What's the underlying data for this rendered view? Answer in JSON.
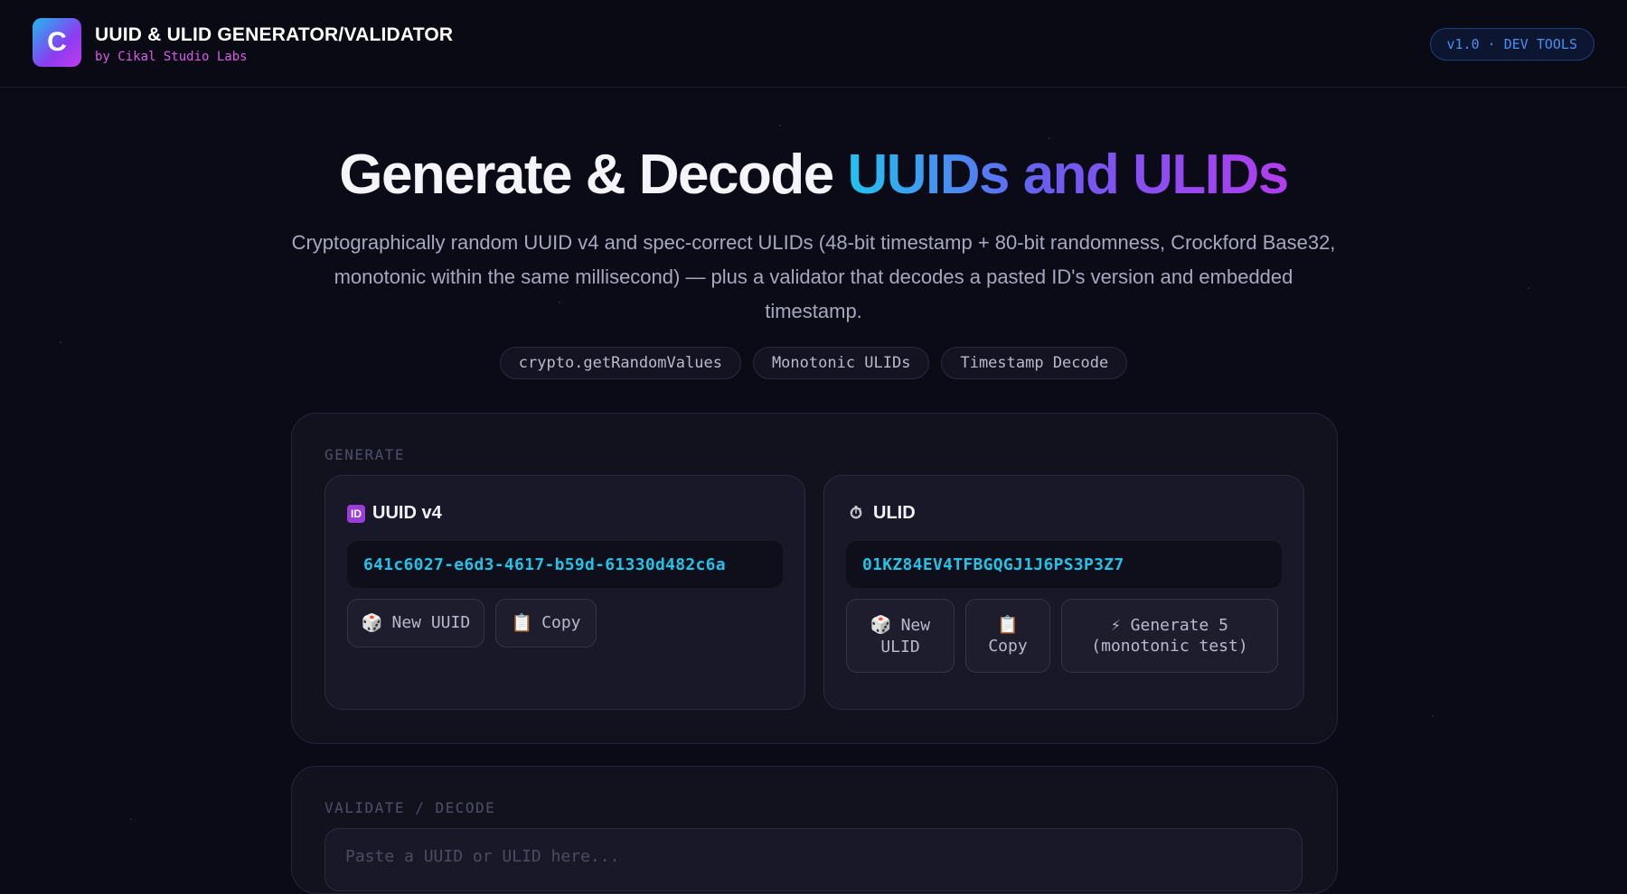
{
  "header": {
    "logo_letter": "C",
    "title": "UUID & ULID GENERATOR/VALIDATOR",
    "subtitle": "by Cikal Studio Labs",
    "version": "v1.0 · DEV TOOLS"
  },
  "hero": {
    "title_plain": "Generate & Decode ",
    "title_highlight": "UUIDs and ULIDs",
    "description": "Cryptographically random UUID v4 and spec-correct ULIDs (48-bit timestamp + 80-bit randomness, Crockford Base32, monotonic within the same millisecond) — plus a validator that decodes a pasted ID's version and embedded timestamp.",
    "chips": [
      "crypto.getRandomValues",
      "Monotonic ULIDs",
      "Timestamp Decode"
    ]
  },
  "generate": {
    "section_label": "GENERATE",
    "uuid": {
      "icon": "id-icon",
      "icon_text": "ID",
      "title": "UUID v4",
      "value": "641c6027-e6d3-4617-b59d-61330d482c6a",
      "new_label": "New UUID",
      "new_emoji": "🎲",
      "copy_label": "Copy",
      "copy_emoji": "📋"
    },
    "ulid": {
      "icon": "stopwatch-icon",
      "icon_text": "⏱",
      "title": "ULID",
      "value": "01KZ84EV4TFBGQGJ1J6PS3P3Z7",
      "new_label_line1": "New",
      "new_label_line2": "ULID",
      "new_emoji": "🎲",
      "copy_label": "Copy",
      "copy_emoji": "📋",
      "batch_line1": "⚡ Generate 5",
      "batch_line2": "(monotonic test)"
    }
  },
  "validate": {
    "section_label": "VALIDATE / DECODE",
    "placeholder": "Paste a UUID or ULID here..."
  },
  "colors": {
    "background": "#0b0b17",
    "accent_cyan": "#22c3e6",
    "accent_purple": "#b33cf0",
    "subtitle_pink": "#d95ce6"
  }
}
